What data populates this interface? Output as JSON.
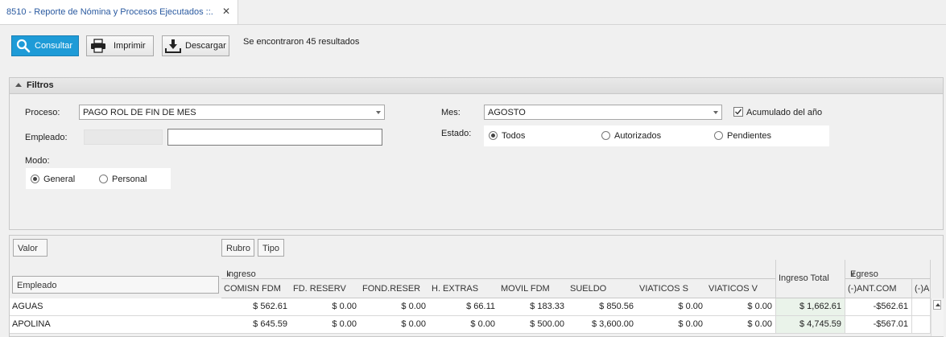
{
  "tab": {
    "title": "8510 - Reporte de Nómina y Procesos Ejecutados ::.",
    "close": "✕"
  },
  "toolbar": {
    "consultar": "Consultar",
    "imprimir": "Imprimir",
    "descargar": "Descargar",
    "results": "Se encontraron 45 resultados"
  },
  "filters": {
    "title": "Filtros",
    "proceso_label": "Proceso:",
    "proceso_value": "PAGO ROL DE FIN DE MES",
    "empleado_label": "Empleado:",
    "empleado_value": "",
    "modo_label": "Modo:",
    "modo_general": "General",
    "modo_personal": "Personal",
    "mes_label": "Mes:",
    "mes_value": "AGOSTO",
    "acumulado_label": "Acumulado del año",
    "acumulado_checked": true,
    "estado_label": "Estado:",
    "estado_todos": "Todos",
    "estado_autorizados": "Autorizados",
    "estado_pendientes": "Pendientes"
  },
  "grid": {
    "valor_btn": "Valor",
    "rubro_btn": "Rubro",
    "tipo_btn": "Tipo",
    "empleado_btn": "Empleado",
    "ingreso_group": "Ingreso",
    "egreso_group": "Egreso",
    "ingreso_total": "Ingreso Total",
    "columns": [
      "COMISN FDM",
      "FD. RESERV",
      "FOND.RESER",
      "H. EXTRAS",
      "MOVIL FDM",
      "SUELDO",
      "VIATICOS S",
      "VIATICOS V"
    ],
    "egreso_columns": [
      "(-)ANT.COM",
      "(-)A"
    ],
    "rows": [
      {
        "name": "AGUAS",
        "values": [
          "$ 562.61",
          "$ 0.00",
          "$ 0.00",
          "$ 66.11",
          "$ 183.33",
          "$ 850.56",
          "$ 0.00",
          "$ 0.00"
        ],
        "total": "$ 1,662.61",
        "egreso": "-$562.61"
      },
      {
        "name": "APOLINA",
        "values": [
          "$ 645.59",
          "$ 0.00",
          "$ 0.00",
          "$ 0.00",
          "$ 500.00",
          "$ 3,600.00",
          "$ 0.00",
          "$ 0.00"
        ],
        "total": "$ 4,745.59",
        "egreso": "-$567.01"
      }
    ]
  },
  "colors": {
    "accent": "#1e9bd7",
    "total_bg": "#eaf3ea",
    "tab_text": "#2a5aa0"
  }
}
